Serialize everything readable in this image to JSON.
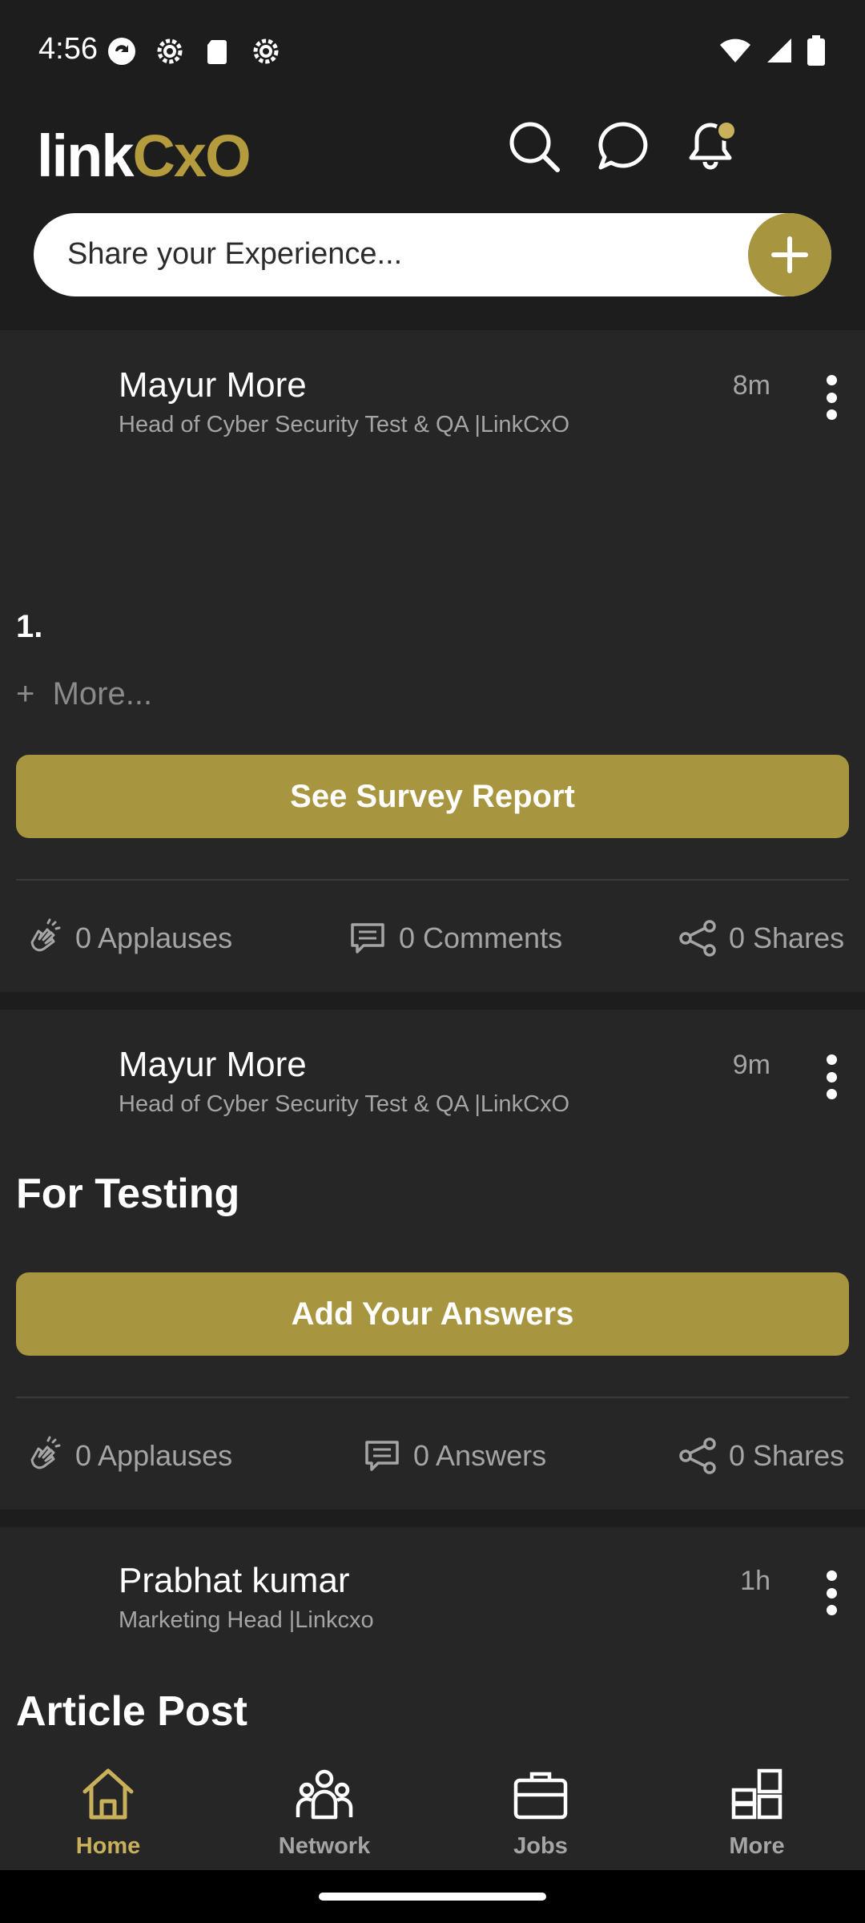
{
  "status_bar": {
    "time": "4:56"
  },
  "app": {
    "logo_left": "link",
    "logo_right": "CxO",
    "share_placeholder": "Share your Experience...",
    "colors": {
      "accent": "#a8953f",
      "background": "#1d1d1d",
      "card": "#262626"
    }
  },
  "posts": [
    {
      "author": "Mayur More",
      "role": "Head of Cyber Security Test & QA |LinkCxO",
      "time": "8m",
      "list_number": "1.",
      "more_label": "+  More...",
      "button_label": "See Survey Report",
      "actions": [
        "0 Applauses",
        "0 Comments",
        "0 Shares"
      ]
    },
    {
      "author": "Mayur More",
      "role": "Head of Cyber Security Test & QA |LinkCxO",
      "time": "9m",
      "title": "For Testing",
      "button_label": "Add Your Answers",
      "actions": [
        "0 Applauses",
        "0 Answers",
        "0 Shares"
      ]
    },
    {
      "author": "Prabhat kumar",
      "role": "Marketing Head |Linkcxo",
      "time": "1h",
      "title": "Article Post"
    }
  ],
  "bottom_nav": [
    {
      "label": "Home",
      "icon": "home-icon",
      "active": true
    },
    {
      "label": "Network",
      "icon": "people-icon",
      "active": false
    },
    {
      "label": "Jobs",
      "icon": "briefcase-icon",
      "active": false
    },
    {
      "label": "More",
      "icon": "grid-icon",
      "active": false
    }
  ]
}
